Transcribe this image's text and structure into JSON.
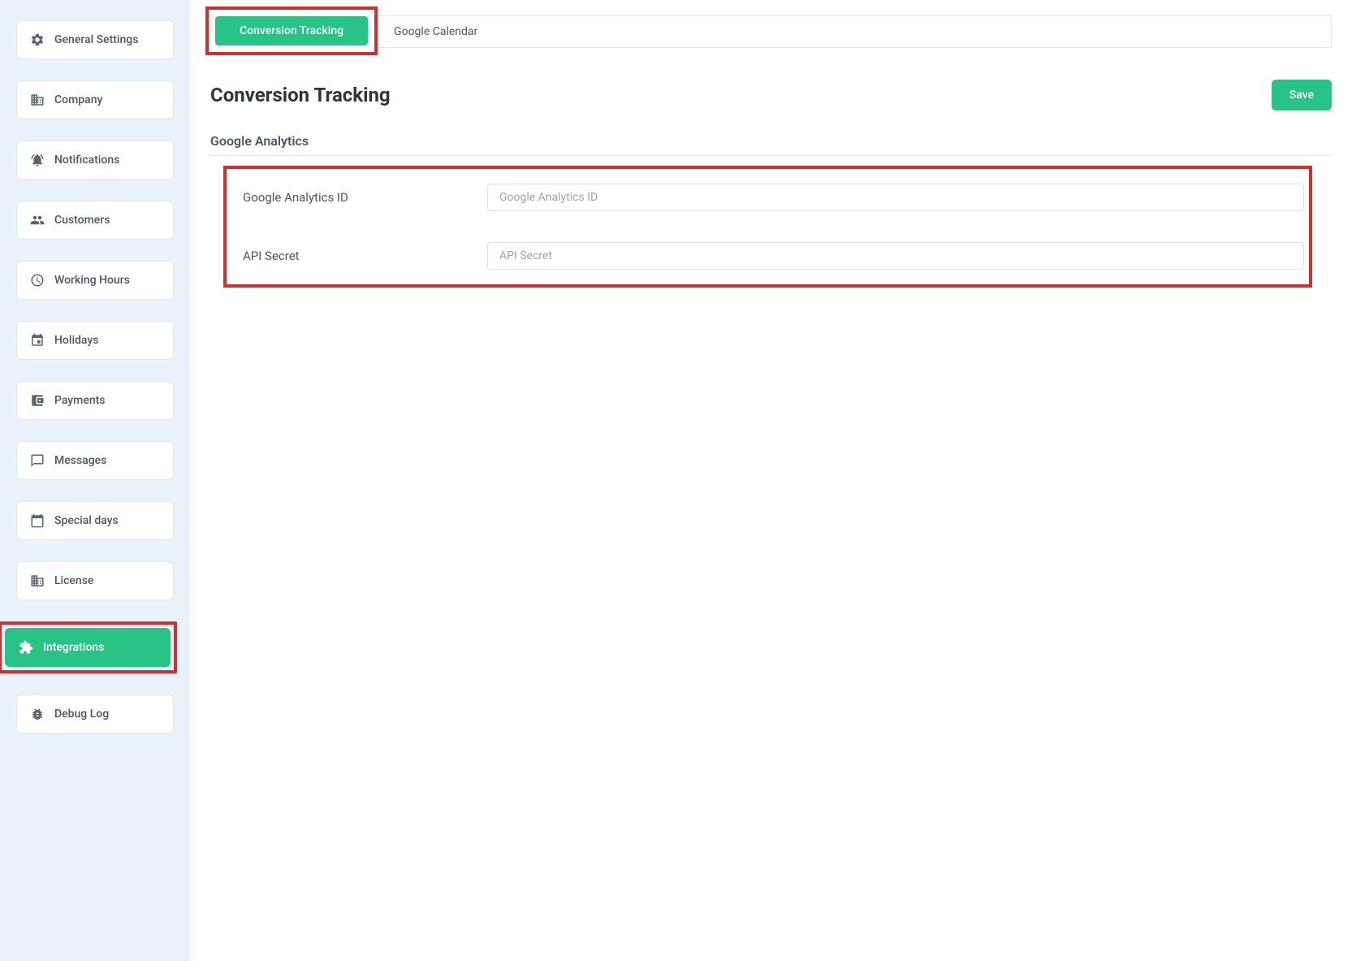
{
  "sidebar": {
    "items": [
      {
        "label": "General Settings",
        "id": "general-settings"
      },
      {
        "label": "Company",
        "id": "company"
      },
      {
        "label": "Notifications",
        "id": "notifications"
      },
      {
        "label": "Customers",
        "id": "customers"
      },
      {
        "label": "Working Hours",
        "id": "working-hours"
      },
      {
        "label": "Holidays",
        "id": "holidays"
      },
      {
        "label": "Payments",
        "id": "payments"
      },
      {
        "label": "Messages",
        "id": "messages"
      },
      {
        "label": "Special days",
        "id": "special-days"
      },
      {
        "label": "License",
        "id": "license"
      },
      {
        "label": "Integrations",
        "id": "integrations"
      },
      {
        "label": "Debug Log",
        "id": "debug-log"
      }
    ]
  },
  "tabs": {
    "active": "Conversion Tracking",
    "inactive": "Google Calendar"
  },
  "page": {
    "title": "Conversion Tracking",
    "save_label": "Save"
  },
  "section": {
    "title": "Google Analytics"
  },
  "form": {
    "ga_id_label": "Google Analytics ID",
    "ga_id_placeholder": "Google Analytics ID",
    "api_secret_label": "API Secret",
    "api_secret_placeholder": "API Secret"
  }
}
